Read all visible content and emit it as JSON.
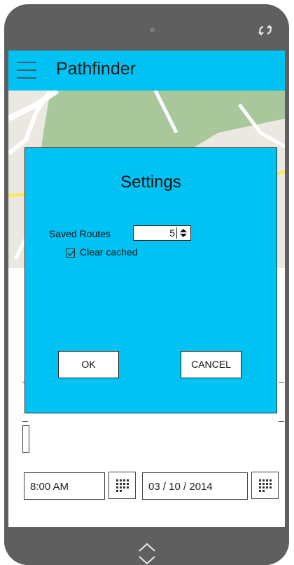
{
  "app": {
    "title": "Pathfinder"
  },
  "form": {
    "time_value": "8:00 AM",
    "date_value": "03 / 10 / 2014"
  },
  "dialog": {
    "title": "Settings",
    "saved_routes_label": "Saved Routes",
    "saved_routes_value": "5",
    "clear_cached_label": "Clear cached",
    "clear_cached_checked": true,
    "ok_label": "OK",
    "cancel_label": "CANCEL"
  },
  "colors": {
    "accent": "#00c2f3",
    "device_frame": "#5f5f5f",
    "map_background": "#ebe8e1",
    "map_park": "#a8c79b",
    "map_road_yellow": "#ffe84d"
  },
  "icons": {
    "menu": "hamburger-icon",
    "rotate": "rotate-icon",
    "calendar": "calendar-grid-icon",
    "stepper": "up-down-arrows-icon",
    "nav": "chevron-up-down-icon"
  }
}
